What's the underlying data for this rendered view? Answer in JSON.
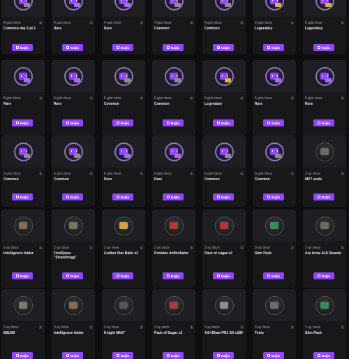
{
  "connect_label": "Bağla",
  "rows": [
    [
      {
        "time": "4 gün önce",
        "qty": "1",
        "name": "Common day 2 pt.1",
        "icon": "twitch-drop-icon",
        "accent": "#8b8b90"
      },
      {
        "time": "4 gün önce",
        "qty": "1",
        "name": "Rare",
        "icon": "twitch-drop-icon",
        "accent": "#a56cff"
      },
      {
        "time": "4 gün önce",
        "qty": "1",
        "name": "Rare",
        "icon": "twitch-drop-icon",
        "accent": "#a56cff"
      },
      {
        "time": "4 gün önce",
        "qty": "1",
        "name": "Common",
        "icon": "twitch-drop-icon",
        "accent": "#8b8b90"
      },
      {
        "time": "4 gün önce",
        "qty": "1",
        "name": "Common",
        "icon": "twitch-drop-icon",
        "accent": "#8b8b90"
      },
      {
        "time": "5 gün önce",
        "qty": "1",
        "name": "Legendary",
        "icon": "twitch-drop-icon",
        "accent": "#d9b23a"
      },
      {
        "time": "5 gün önce",
        "qty": "1",
        "name": "Legendary",
        "icon": "twitch-drop-icon",
        "accent": "#d9b23a"
      }
    ],
    [
      {
        "time": "5 gün önce",
        "qty": "1",
        "name": "Rare",
        "icon": "twitch-drop-icon",
        "accent": "#a56cff"
      },
      {
        "time": "5 gün önce",
        "qty": "1",
        "name": "Rare",
        "icon": "twitch-drop-icon",
        "accent": "#a56cff"
      },
      {
        "time": "5 gün önce",
        "qty": "1",
        "name": "Common",
        "icon": "twitch-drop-icon",
        "accent": "#8b8b90"
      },
      {
        "time": "5 gün önce",
        "qty": "1",
        "name": "Common",
        "icon": "twitch-drop-icon",
        "accent": "#8b8b90"
      },
      {
        "time": "5 gün önce",
        "qty": "1",
        "name": "Legendary",
        "icon": "twitch-drop-icon",
        "accent": "#d9b23a"
      },
      {
        "time": "5 gün önce",
        "qty": "1",
        "name": "Rare",
        "icon": "twitch-drop-icon",
        "accent": "#a56cff"
      },
      {
        "time": "5 gün önce",
        "qty": "1",
        "name": "Rare",
        "icon": "twitch-drop-icon",
        "accent": "#a56cff"
      }
    ],
    [
      {
        "time": "5 gün önce",
        "qty": "1",
        "name": "Common",
        "icon": "twitch-drop-icon",
        "accent": "#8b8b90"
      },
      {
        "time": "5 gün önce",
        "qty": "1",
        "name": "Common",
        "icon": "twitch-drop-icon",
        "accent": "#8b8b90"
      },
      {
        "time": "6 gün önce",
        "qty": "1",
        "name": "Rare",
        "icon": "twitch-drop-icon",
        "accent": "#a56cff"
      },
      {
        "time": "6 gün önce",
        "qty": "1",
        "name": "Rare",
        "icon": "twitch-drop-icon",
        "accent": "#a56cff"
      },
      {
        "time": "6 gün önce",
        "qty": "1",
        "name": "Common",
        "icon": "twitch-drop-icon",
        "accent": "#8b8b90"
      },
      {
        "time": "6 gün önce",
        "qty": "1",
        "name": "Common",
        "icon": "twitch-drop-icon",
        "accent": "#8b8b90"
      },
      {
        "time": "2 ay önce",
        "qty": "1",
        "name": "MP7 seals",
        "icon": "gun-seals-icon",
        "accent": "#6a6a6a"
      }
    ],
    [
      {
        "time": "2 ay önce",
        "qty": "1",
        "name": "Intelligence folder",
        "icon": "folder-icon",
        "accent": "#8a6a55"
      },
      {
        "time": "2 ay önce",
        "qty": "1",
        "name": "FirstSpear \"Strandhogg\"",
        "icon": "vest-icon",
        "accent": "#7a7460"
      },
      {
        "time": "2 ay önce",
        "qty": "1",
        "name": "Golden Star Balm x2",
        "icon": "balm-icon",
        "accent": "#c9a64a"
      },
      {
        "time": "3 ay önce",
        "qty": "1",
        "name": "Portable defibrillator",
        "icon": "defibrillator-icon",
        "accent": "#b33a2e"
      },
      {
        "time": "3 ay önce",
        "qty": "1",
        "name": "Pack of sugar x2",
        "icon": "sugar-pack-icon",
        "accent": "#a83c3c"
      },
      {
        "time": "3 ay önce",
        "qty": "1",
        "name": "Stim Pack",
        "icon": "stim-pack-icon",
        "accent": "#3f8a5a"
      },
      {
        "time": "3 ay önce",
        "qty": "1",
        "name": "Ars Arma A18 Skanda",
        "icon": "armor-icon",
        "accent": "#6b6b5e"
      }
    ],
    [
      {
        "time": "3 ay önce",
        "qty": "1",
        "name": "6B13M",
        "icon": "armor-vest-icon",
        "accent": "#7a7a70"
      },
      {
        "time": "3 ay önce",
        "qty": "1",
        "name": "Intelligence folder",
        "icon": "folder-icon",
        "accent": "#8a6a55"
      },
      {
        "time": "3 ay önce",
        "qty": "1",
        "name": "Knight Mk47",
        "icon": "rifle-icon",
        "accent": "#555555"
      },
      {
        "time": "3 ay önce",
        "qty": "1",
        "name": "Pack of Sugar x2",
        "icon": "sugar-pack-icon",
        "accent": "#a83c3c"
      },
      {
        "time": "3 ay önce",
        "qty": "1",
        "name": "4.6×30мм FMJ SX x180",
        "icon": "ammo-box-icon",
        "accent": "#8d8d8d"
      },
      {
        "time": "3 ay önce",
        "qty": "1",
        "name": "Tetriz",
        "icon": "tetriz-icon",
        "accent": "#6a6a74"
      },
      {
        "time": "3 ay önce",
        "qty": "1",
        "name": "Stim Pack",
        "icon": "stim-pack-icon",
        "accent": "#3f8a5a"
      }
    ]
  ]
}
